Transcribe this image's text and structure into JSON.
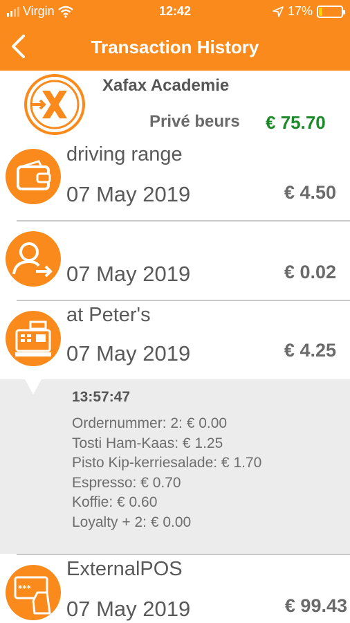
{
  "status_bar": {
    "carrier": "Virgin",
    "time": "12:42",
    "battery": "17%",
    "battery_level": 0.17
  },
  "nav": {
    "title": "Transaction History"
  },
  "account": {
    "name": "Xafax Academie",
    "balance_label": "Privé beurs",
    "balance_value": "€ 75.70"
  },
  "transactions": [
    {
      "name": "driving range",
      "date": "07 May 2019",
      "amount": "€ 4.50",
      "icon": "wallet-icon"
    },
    {
      "name": "",
      "date": "07 May 2019",
      "amount": "€ 0.02",
      "icon": "user-transfer-icon"
    },
    {
      "name": "at Peter's",
      "date": "07 May 2019",
      "amount": "€ 4.25",
      "icon": "cash-register-icon"
    },
    {
      "name": "ExternalPOS",
      "date": "07 May 2019",
      "amount": "€ 99.43",
      "icon": "card-terminal-icon"
    }
  ],
  "detail": {
    "time": "13:57:47",
    "lines": [
      "Ordernummer: 2: € 0.00",
      "Tosti Ham-Kaas: € 1.25",
      "Pisto Kip-kerriesalade: € 1.70",
      "Espresso: € 0.70",
      "Koffie: € 0.60",
      "Loyalty + 2: € 0.00"
    ]
  },
  "colors": {
    "accent": "#f98a1b",
    "positive": "#1c8a2a"
  }
}
